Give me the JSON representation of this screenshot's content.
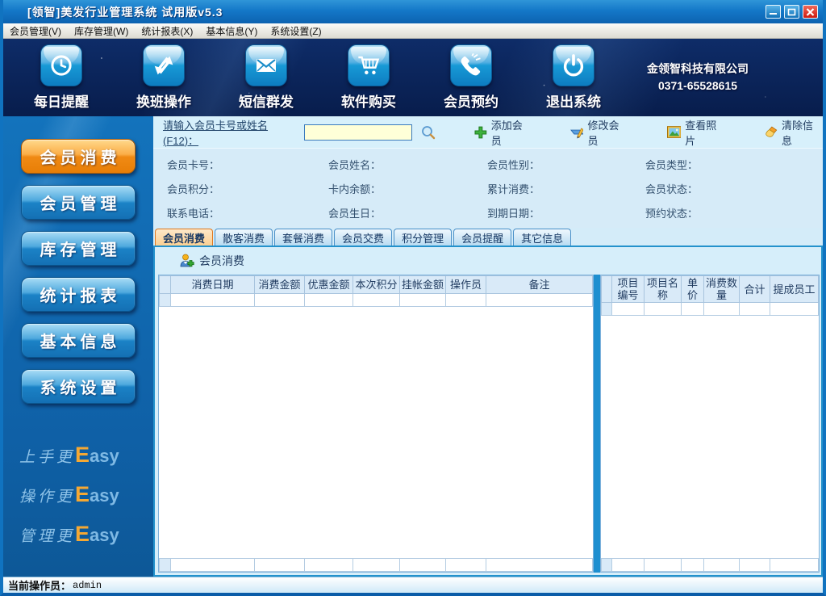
{
  "window": {
    "title": "[领智]美发行业管理系统 试用版v5.3"
  },
  "menu": {
    "items": [
      "会员管理(V)",
      "库存管理(W)",
      "统计报表(X)",
      "基本信息(Y)",
      "系统设置(Z)"
    ]
  },
  "toolbar": {
    "buttons": [
      {
        "label": "每日提醒",
        "icon": "clock-icon"
      },
      {
        "label": "换班操作",
        "icon": "swap-arrows-icon"
      },
      {
        "label": "短信群发",
        "icon": "envelope-icon"
      },
      {
        "label": "软件购买",
        "icon": "cart-icon"
      },
      {
        "label": "会员预约",
        "icon": "phone-icon"
      },
      {
        "label": "退出系统",
        "icon": "power-icon"
      }
    ],
    "company_name": "金领智科技有限公司",
    "company_phone": "0371-65528615"
  },
  "sidebar": {
    "buttons": [
      {
        "label": "会员消费",
        "active": true
      },
      {
        "label": "会员管理",
        "active": false
      },
      {
        "label": "库存管理",
        "active": false
      },
      {
        "label": "统计报表",
        "active": false
      },
      {
        "label": "基本信息",
        "active": false
      },
      {
        "label": "系统设置",
        "active": false
      }
    ],
    "slogans": [
      {
        "zh": "上手更",
        "e": "E",
        "asy": "asy"
      },
      {
        "zh": "操作更",
        "e": "E",
        "asy": "asy"
      },
      {
        "zh": "管理更",
        "e": "E",
        "asy": "asy"
      }
    ]
  },
  "search": {
    "label": "请输入会员卡号或姓名(F12)：",
    "value": "",
    "actions": [
      "添加会员",
      "修改会员",
      "查看照片",
      "清除信息"
    ]
  },
  "member_info": {
    "fields": [
      "会员卡号：",
      "会员姓名：",
      "会员性别：",
      "会员类型：",
      "会员积分：",
      "卡内余额：",
      "累计消费：",
      "会员状态：",
      "联系电话：",
      "会员生日：",
      "到期日期：",
      "预约状态："
    ]
  },
  "tabs": {
    "items": [
      "会员消费",
      "散客消费",
      "套餐消费",
      "会员交费",
      "积分管理",
      "会员提醒",
      "其它信息"
    ],
    "active_index": 0
  },
  "consume": {
    "button_label": "会员消费"
  },
  "left_table": {
    "headers": [
      "消费日期",
      "消费金额",
      "优惠金额",
      "本次积分",
      "挂帐金额",
      "操作员",
      "备注"
    ]
  },
  "right_table": {
    "headers": [
      "项目编号",
      "项目名称",
      "单价",
      "消费数量",
      "合计",
      "提成员工"
    ]
  },
  "status": {
    "label": "当前操作员：",
    "value": "admin"
  },
  "colors": {
    "titlebar_blue": "#1478c8",
    "toolbar_navy": "#081d4c",
    "sidebar_blue": "#0f60a6",
    "active_orange": "#f08a14",
    "panel_light_blue": "#d4ecf9",
    "table_header_blue": "#d9eaf8",
    "frame_blue": "#1073c0",
    "input_yellow": "#ffffd8",
    "tab_active_bg": "#fbcf92"
  }
}
